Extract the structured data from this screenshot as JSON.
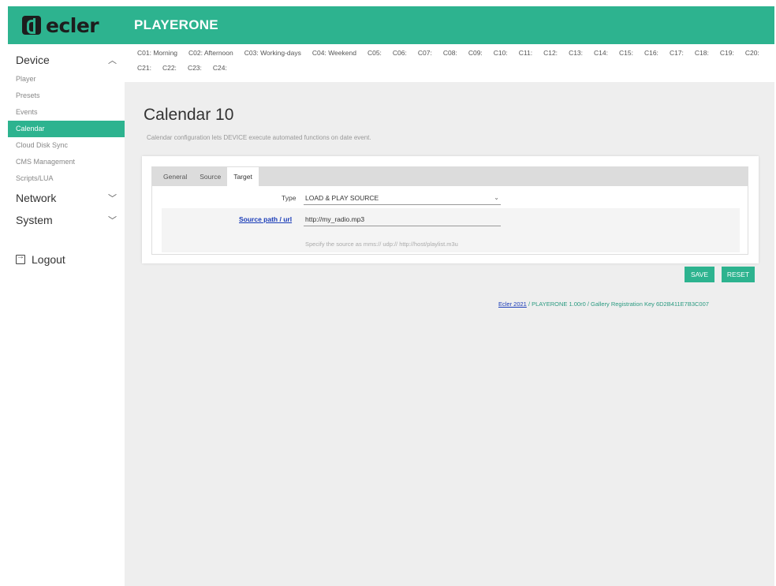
{
  "header": {
    "logo_text": "ecler",
    "app_title": "PLAYERONE",
    "accent_color": "#2db38f"
  },
  "sidebar": {
    "device_label": "Device",
    "device_items": [
      "Player",
      "Presets",
      "Events",
      "Calendar",
      "Cloud Disk Sync",
      "CMS Management",
      "Scripts/LUA"
    ],
    "active_item": "Calendar",
    "network_label": "Network",
    "system_label": "System",
    "logout_label": "Logout"
  },
  "calendar_tabs": [
    "C01: Morning",
    "C02: Afternoon",
    "C03: Working-days",
    "C04: Weekend",
    "C05:",
    "C06:",
    "C07:",
    "C08:",
    "C09:",
    "C10:",
    "C11:",
    "C12:",
    "C13:",
    "C14:",
    "C15:",
    "C16:",
    "C17:",
    "C18:",
    "C19:",
    "C20:",
    "C21:",
    "C22:",
    "C23:",
    "C24:"
  ],
  "page": {
    "title": "Calendar 10",
    "description": "Calendar configuration lets DEVICE execute automated functions on date event."
  },
  "form": {
    "tabs": [
      "General",
      "Source",
      "Target"
    ],
    "active_tab": "Target",
    "type_label": "Type",
    "type_value": "LOAD & PLAY SOURCE",
    "source_label": "Source path / url",
    "source_value": "http://my_radio.mp3",
    "source_hint": "Specify the source as mms:// udp:// http://host/playlist.m3u"
  },
  "buttons": {
    "save": "SAVE",
    "reset": "RESET"
  },
  "footer": {
    "link_text": "Ecler 2021",
    "text": " / PLAYERONE 1.00r0 / Gallery Registration Key 6D2B411E7B3C007"
  }
}
